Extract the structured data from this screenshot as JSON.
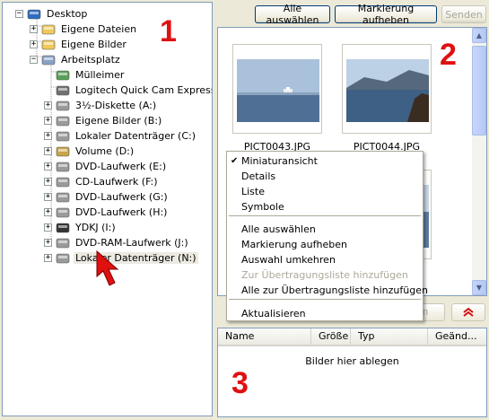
{
  "tree": {
    "items": [
      {
        "label": "Desktop",
        "icon": "desktop-icon",
        "expander": "−"
      },
      {
        "label": "Eigene Dateien",
        "icon": "folder-icon",
        "expander": "+"
      },
      {
        "label": "Eigene Bilder",
        "icon": "pictures-folder-icon",
        "expander": "+"
      },
      {
        "label": "Arbeitsplatz",
        "icon": "computer-icon",
        "expander": "−"
      },
      {
        "label": "Mülleimer",
        "icon": "recycle-bin-icon",
        "expander": ""
      },
      {
        "label": "Logitech Quick Cam Express",
        "icon": "webcam-icon",
        "expander": ""
      },
      {
        "label": "3½-Diskette (A:)",
        "icon": "floppy-drive-icon",
        "expander": "+"
      },
      {
        "label": "Eigene Bilder (B:)",
        "icon": "network-drive-icon",
        "expander": "+"
      },
      {
        "label": "Lokaler Datenträger (C:)",
        "icon": "hard-drive-icon",
        "expander": "+"
      },
      {
        "label": "Volume (D:)",
        "icon": "drive-folder-icon",
        "expander": "+"
      },
      {
        "label": "DVD-Laufwerk (E:)",
        "icon": "dvd-drive-icon",
        "expander": "+"
      },
      {
        "label": "CD-Laufwerk (F:)",
        "icon": "cd-drive-icon",
        "expander": "+"
      },
      {
        "label": "DVD-Laufwerk (G:)",
        "icon": "dvd-drive-icon",
        "expander": "+"
      },
      {
        "label": "DVD-Laufwerk (H:)",
        "icon": "dvd-drive-icon",
        "expander": "+"
      },
      {
        "label": "YDKJ (I:)",
        "icon": "game-disc-icon",
        "expander": "+"
      },
      {
        "label": "DVD-RAM-Laufwerk (J:)",
        "icon": "dvd-ram-drive-icon",
        "expander": "+"
      },
      {
        "label": "Lokaler Datenträger (N:)",
        "icon": "hard-drive-icon",
        "expander": "+"
      }
    ]
  },
  "annotations": {
    "one": "1",
    "two": "2",
    "three": "3"
  },
  "toolbar": {
    "select_all": "Alle auswählen",
    "clear_selection": "Markierung aufheben",
    "send": "Senden"
  },
  "thumbnails": [
    {
      "filename": "PICT0043.JPG"
    },
    {
      "filename": "PICT0044.JPG"
    }
  ],
  "context_menu": {
    "items": [
      {
        "label": "Miniaturansicht",
        "checked": true,
        "disabled": false
      },
      {
        "label": "Details",
        "checked": false,
        "disabled": false
      },
      {
        "label": "Liste",
        "checked": false,
        "disabled": false
      },
      {
        "label": "Symbole",
        "checked": false,
        "disabled": false
      },
      {
        "label": "Alle auswählen",
        "checked": false,
        "disabled": false
      },
      {
        "label": "Markierung aufheben",
        "checked": false,
        "disabled": false
      },
      {
        "label": "Auswahl umkehren",
        "checked": false,
        "disabled": false
      },
      {
        "label": "Zur Übertragungsliste hinzufügen",
        "checked": false,
        "disabled": true
      },
      {
        "label": "Alle zur Übertragungsliste hinzufügen",
        "checked": false,
        "disabled": false
      },
      {
        "label": "Aktualisieren",
        "checked": false,
        "disabled": false
      }
    ]
  },
  "lower_buttons": {
    "partial_label": "hen",
    "collapse_icon": "double-chevron-up-icon"
  },
  "list": {
    "columns": [
      "Name",
      "Größe",
      "Typ",
      "Geänd..."
    ],
    "empty_text": "Bilder hier ablegen"
  },
  "colors": {
    "annotation_red": "#e01010",
    "xp_border": "#7f9db9"
  }
}
